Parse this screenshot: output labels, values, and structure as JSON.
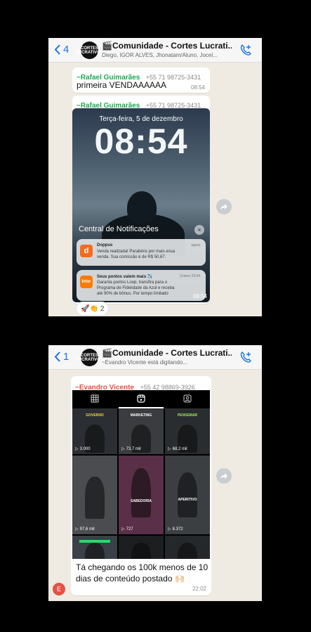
{
  "screen1": {
    "back_count": "4",
    "group_title": "🎬Comunidade - Cortes Lucrati...",
    "group_subtitle": "Diego, IGOR ALVES, Jhonatam/Aluno, Jocel...",
    "avatar_text": "CORTES LUCRATIVOS",
    "message1": {
      "sender": "~Rafael Guimarães",
      "phone": "+55 71 98725-3431",
      "text": "primeira VENDAAAAAA",
      "time": "08:54"
    },
    "message2": {
      "sender": "~Rafael Guimarães",
      "phone": "+55 71 98725-3431",
      "time": "08:54",
      "lockscreen": {
        "date": "Terça-feira, 5 de dezembro",
        "clock": "08:54",
        "notification_center": "Central de Notificações",
        "close_icon": "×",
        "notifications": [
          {
            "app": "Doppus",
            "icon_text": "d",
            "icon_color": "#f36c1f",
            "when": "agora",
            "body": "Venda realizada! Parabéns por mais essa venda. Sua comissão é de R$ 50,67."
          },
          {
            "app": "Seus pontos valem mais ✈️",
            "icon_text": "Inter",
            "icon_color": "#ff7a00",
            "when": "Ontem 23:04",
            "body": "Garanta pontos Loop, transfira para o Programa de Fidelidade da Azul e receba até 90% de bônus. Por tempo limitado"
          }
        ]
      },
      "reactions": "🚀👏",
      "reaction_count": "2"
    }
  },
  "screen2": {
    "back_count": "1",
    "group_title": "🎬Comunidade - Cortes Lucrati...",
    "group_subtitle": "~Evandro Vicente está digitando...",
    "avatar_text": "CORTES LUCRATIVOS",
    "message": {
      "sender": "~Evandro Vicente",
      "phone": "+55 42 98869-3926",
      "text": "Tá chegando os 100k menos de 10 dias de conteúdo postado 🙌🏻",
      "time": "22:02",
      "sender_initial": "E"
    },
    "reels": [
      {
        "caption": "GOVERNO",
        "views": "3.000",
        "color": "#2b2f33"
      },
      {
        "caption": "MARKETING",
        "views": "73,7 mil",
        "color": "#3a3c3f"
      },
      {
        "caption": "PENSEMAR",
        "views": "68,2 mil",
        "color": "#2a2d30"
      },
      {
        "caption": "",
        "views": "97,6 mil",
        "color": "#4a4c4f"
      },
      {
        "caption": "SABEDORIA",
        "views": "727",
        "color": "#5a2f48"
      },
      {
        "caption": "APERITIVO",
        "views": "8.372",
        "color": "#3c3f42"
      }
    ]
  },
  "colors": {
    "sender_green": "#1fa855",
    "sender_red": "#e35146",
    "link_blue": "#1a73e8",
    "chat_bg": "#efeae2"
  }
}
